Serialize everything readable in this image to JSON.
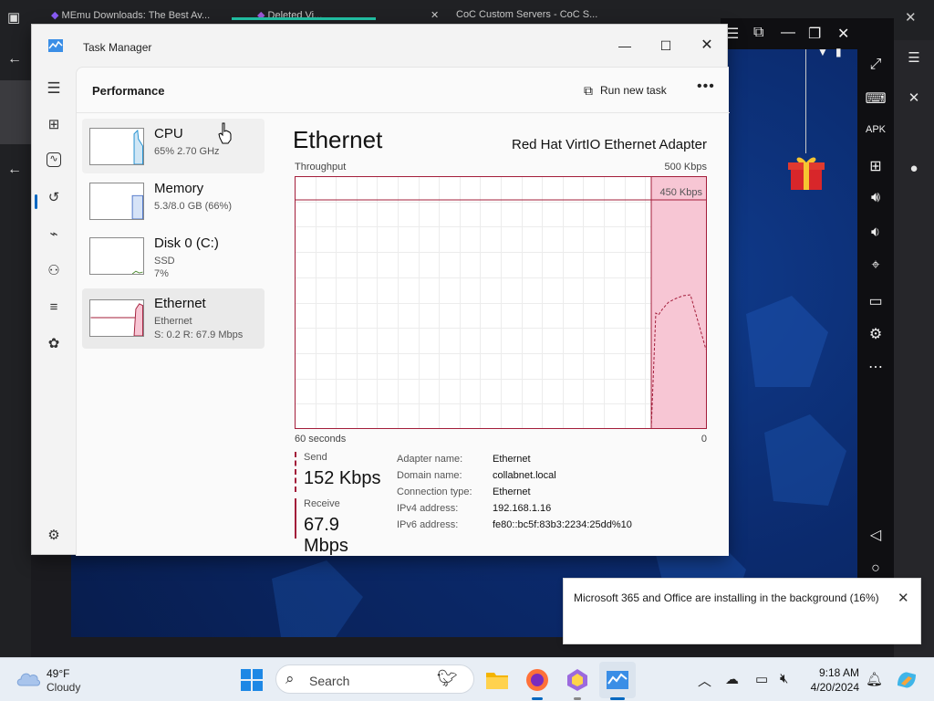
{
  "window": {
    "title": "Task Manager"
  },
  "header": {
    "page_title": "Performance",
    "run_new_task": "Run new task"
  },
  "resources": [
    {
      "name": "CPU",
      "line1": "65%  2.70 GHz",
      "line2": ""
    },
    {
      "name": "Memory",
      "line1": "5.3/8.0 GB (66%)",
      "line2": ""
    },
    {
      "name": "Disk 0 (C:)",
      "line1": "SSD",
      "line2": "7%"
    },
    {
      "name": "Ethernet",
      "line1": "Ethernet",
      "line2": "S: 0.2  R: 67.9 Mbps"
    }
  ],
  "detail": {
    "title": "Ethernet",
    "adapter": "Red Hat VirtIO Ethernet Adapter",
    "throughput_label": "Throughput",
    "max_label": "500 Kbps",
    "inner_scale_label": "450 Kbps",
    "time_label": "60 seconds",
    "zero_label": "0",
    "send_label": "Send",
    "send_value": "152 Kbps",
    "receive_label": "Receive",
    "receive_value": "67.9 Mbps",
    "properties": [
      {
        "key": "Adapter name:",
        "value": "Ethernet"
      },
      {
        "key": "Domain name:",
        "value": "collabnet.local"
      },
      {
        "key": "Connection type:",
        "value": "Ethernet"
      },
      {
        "key": "IPv4 address:",
        "value": "192.168.1.16"
      },
      {
        "key": "IPv6 address:",
        "value": "fe80::bc5f:83b3:2234:25dd%10"
      }
    ]
  },
  "toast": {
    "message": "Microsoft 365 and Office are installing in the background (16%)"
  },
  "taskbar": {
    "weather_temp": "49°F",
    "weather_desc": "Cloudy",
    "search_placeholder": "Search",
    "time": "9:18 AM",
    "date": "4/20/2024"
  },
  "background_browser": {
    "tab1": "MEmu Downloads: The Best Av...",
    "tab2": "Deleted Vi...",
    "tab3": "CoC Custom Servers - CoC S..."
  },
  "colors": {
    "ethernet_accent": "#a31d3a",
    "ethernet_fill": "#f7c6d4",
    "accent": "#0067c0"
  }
}
